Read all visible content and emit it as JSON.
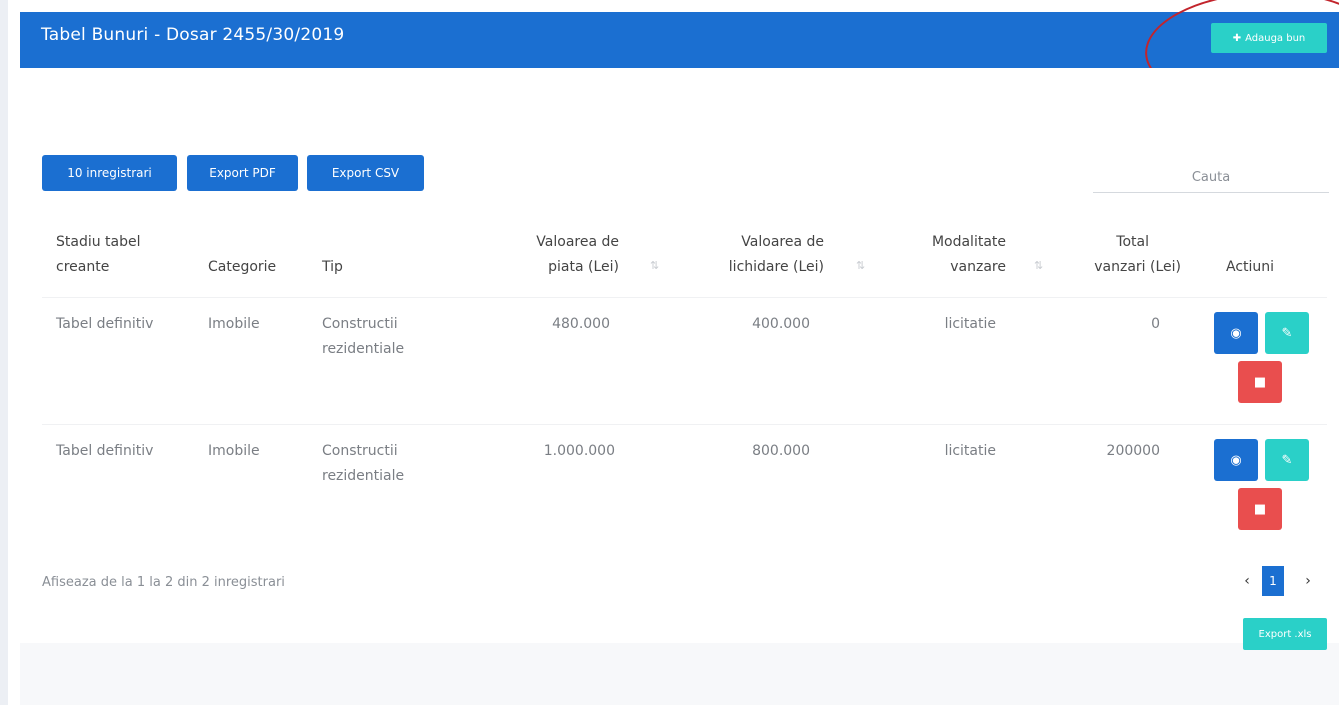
{
  "header": {
    "title": "Tabel Bunuri - Dosar 2455/30/2019",
    "add_button": "Adauga bun",
    "add_icon": "plus-icon"
  },
  "toolbar": {
    "records_button": "10 inregistrari",
    "export_pdf": "Export PDF",
    "export_csv": "Export CSV",
    "search_placeholder": "Cauta"
  },
  "table": {
    "headers": [
      {
        "line1": "Stadiu tabel",
        "line2": "creante"
      },
      {
        "line1": "",
        "line2": "Categorie"
      },
      {
        "line1": "",
        "line2": "Tip"
      },
      {
        "line1": "Valoarea de",
        "line2": "piata (Lei)"
      },
      {
        "line1": "Valoarea de",
        "line2": "lichidare (Lei)"
      },
      {
        "line1": "Modalitate",
        "line2": "vanzare"
      },
      {
        "line1": "Total",
        "line2": "vanzari (Lei)"
      },
      {
        "line1": "",
        "line2": "Actiuni"
      }
    ],
    "rows": [
      {
        "stadiu": "Tabel definitiv",
        "categorie": "Imobile",
        "tip_line1": "Constructii",
        "tip_line2": "rezidentiale",
        "valoare_piata": "480.000",
        "valoare_lichidare": "400.000",
        "modalitate": "licitatie",
        "total_vanzari": "0"
      },
      {
        "stadiu": "Tabel definitiv",
        "categorie": "Imobile",
        "tip_line1": "Constructii",
        "tip_line2": "rezidentiale",
        "valoare_piata": "1.000.000",
        "valoare_lichidare": "800.000",
        "modalitate": "licitatie",
        "total_vanzari": "200000"
      }
    ],
    "action_icons": {
      "view": "eye-icon",
      "edit": "pencil-icon",
      "delete": "trash-icon"
    }
  },
  "footer": {
    "info": "Afiseaza de la 1 la 2 din 2 inregistrari",
    "pagination": {
      "prev": "‹",
      "current": "1",
      "next": "›"
    },
    "export_xls": "Export .xls"
  },
  "colors": {
    "primary": "#1b6fd1",
    "accent": "#2ad0c8",
    "danger": "#e94e4e",
    "annotation": "#c2242c"
  }
}
